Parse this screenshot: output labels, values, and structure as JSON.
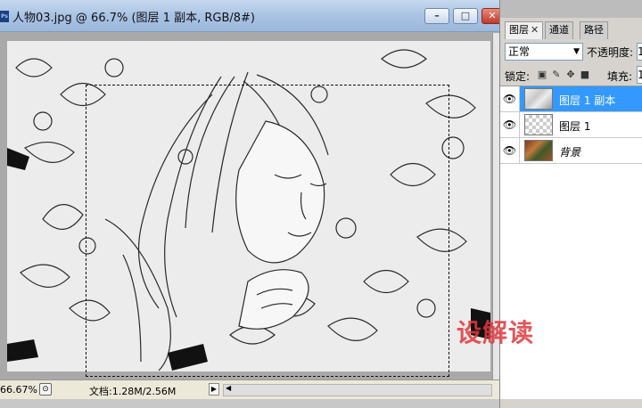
{
  "document": {
    "title": "人物03.jpg @ 66.7% (图层 1 副本, RGB/8#)",
    "app_icon": "Ps",
    "window_buttons": {
      "minimize": "–",
      "maximize": "□",
      "close": "✕"
    }
  },
  "status": {
    "zoom": "66.67%",
    "doc_info": "文档:1.28M/2.56M",
    "menu_arrow": "▶",
    "scroll_left": "◀"
  },
  "panel": {
    "tabs": [
      {
        "label": "图层",
        "close": "✕"
      },
      {
        "label": "通道"
      },
      {
        "label": "路径"
      }
    ],
    "blend_mode": "正常",
    "opacity_label": "不透明度:",
    "opacity_value": "1",
    "lock_label": "锁定:",
    "fill_label": "填充:",
    "fill_value": "1",
    "layers": [
      {
        "name": "图层 1 副本",
        "selected": true,
        "visible_icon": "eye-icon"
      },
      {
        "name": "图层 1",
        "selected": false,
        "visible_icon": "eye-icon"
      },
      {
        "name": "背景",
        "selected": false,
        "visible_icon": "eye-icon"
      }
    ]
  },
  "watermark": "设解读",
  "colors": {
    "selected_layer": "#3399ff",
    "watermark": "#e0383e"
  }
}
